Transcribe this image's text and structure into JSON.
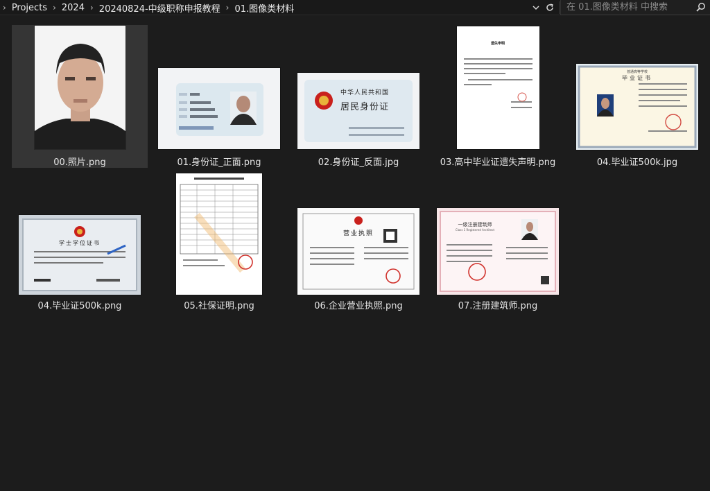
{
  "breadcrumb": [
    "Projects",
    "2024",
    "20240824-中级职称申报教程",
    "01.图像类材料"
  ],
  "search": {
    "placeholder": "在 01.图像类材料 中搜索"
  },
  "icons": {
    "separator": "chevron-right-icon",
    "history": "chevron-down-icon",
    "refresh": "refresh-icon",
    "search": "search-icon"
  },
  "files": [
    {
      "name": "00.照片.png",
      "selected": true
    },
    {
      "name": "01.身份证_正面.png",
      "selected": false
    },
    {
      "name": "02.身份证_反面.jpg",
      "selected": false
    },
    {
      "name": "03.高中毕业证遗失声明.png",
      "selected": false
    },
    {
      "name": "04.毕业证500k.jpg",
      "selected": false
    },
    {
      "name": "04.毕业证500k.png",
      "selected": false
    },
    {
      "name": "05.社保证明.png",
      "selected": false
    },
    {
      "name": "06.企业营业执照.png",
      "selected": false
    },
    {
      "name": "07.注册建筑师.png",
      "selected": false
    }
  ],
  "thumbnails": {
    "id_back": {
      "country": "中华人民共和国",
      "card": "居民身份证"
    },
    "loss_notice": {
      "title": "遗失申明"
    },
    "diploma": {
      "school": "普通高等学校",
      "title": "毕业证书"
    },
    "degree": {
      "title": "学士学位证书"
    },
    "license": {
      "title": "营业执照"
    },
    "architect": {
      "title": "一级注册建筑师",
      "subtitle": "Class 1 Registered Architect"
    }
  }
}
